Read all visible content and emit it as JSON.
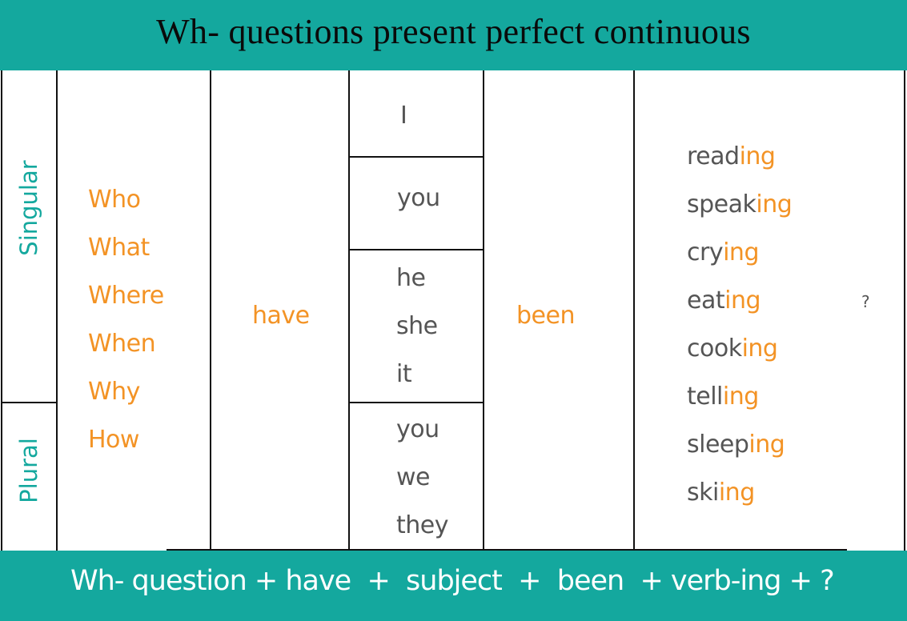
{
  "header": {
    "title": "Wh- questions present perfect continuous"
  },
  "row_labels": {
    "singular": "Singular",
    "plural": "Plural"
  },
  "columns": {
    "wh_words": [
      "Who",
      "What",
      "Where",
      "When",
      "Why",
      "How"
    ],
    "auxiliary": "have",
    "subjects": {
      "first": [
        "I"
      ],
      "second": [
        "you"
      ],
      "third": [
        "he",
        "she",
        "it"
      ],
      "plural": [
        "you",
        "we",
        "they"
      ]
    },
    "been": "been",
    "verbs": [
      {
        "stem": "read",
        "suffix": "ing"
      },
      {
        "stem": "speak",
        "suffix": "ing"
      },
      {
        "stem": "cry",
        "suffix": "ing"
      },
      {
        "stem": "eat",
        "suffix": "ing"
      },
      {
        "stem": "cook",
        "suffix": "ing"
      },
      {
        "stem": "tell",
        "suffix": "ing"
      },
      {
        "stem": "sleep",
        "suffix": "ing"
      },
      {
        "stem": "ski",
        "suffix": "ing"
      }
    ],
    "question_mark": "?"
  },
  "footer": {
    "formula": "Wh- question + have  +  subject  +  been  + verb-ing + ?"
  },
  "colors": {
    "teal": "#14a89e",
    "orange": "#f39325",
    "gray_text": "#555555"
  }
}
